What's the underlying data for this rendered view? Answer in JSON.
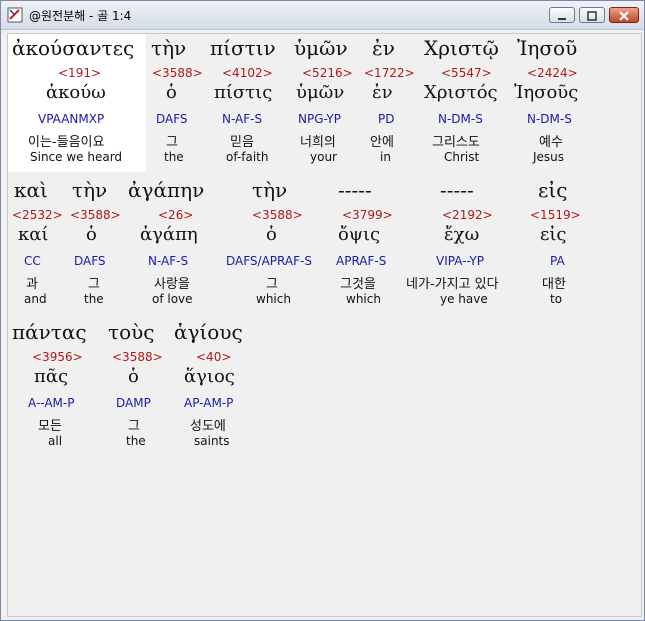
{
  "window": {
    "title": "@원전분해 - 골 1:4"
  },
  "icons": [
    "app-icon",
    "minimize-icon",
    "maximize-icon",
    "close-icon"
  ],
  "colors": {
    "strong": "#b01818",
    "parse": "#1a1aa8"
  },
  "rows": [
    [
      {
        "greek": "ἀκούσαντες",
        "strong": "<191>",
        "lemma": "ἀκούω",
        "parse": "VPAANMXP",
        "korean": "이는-들음이요",
        "english": "Since we heard"
      },
      {
        "greek": "τὴν",
        "strong": "<3588>",
        "lemma": "ὁ",
        "parse": "DAFS",
        "korean": "그",
        "english": "the"
      },
      {
        "greek": "πίστιν",
        "strong": "<4102>",
        "lemma": "πίστις",
        "parse": "N-AF-S",
        "korean": "믿음",
        "english": "of-faith"
      },
      {
        "greek": "ὑμῶν",
        "strong": "<5216>",
        "lemma": "ὑμῶν",
        "parse": "NPG-YP",
        "korean": "너희의",
        "english": "your"
      },
      {
        "greek": "ἐν",
        "strong": "<1722>",
        "lemma": "ἐν",
        "parse": "PD",
        "korean": "안에",
        "english": "in"
      },
      {
        "greek": "Χριστῷ",
        "strong": "<5547>",
        "lemma": "Χριστός",
        "parse": "N-DM-S",
        "korean": "그리스도",
        "english": "Christ"
      },
      {
        "greek": "Ἰησοῦ",
        "strong": "<2424>",
        "lemma": "Ἰησοῦς",
        "parse": "N-DM-S",
        "korean": "예수",
        "english": "Jesus"
      }
    ],
    [
      {
        "greek": "καὶ",
        "strong": "<2532>",
        "lemma": "καί",
        "parse": "CC",
        "korean": "과",
        "english": "and"
      },
      {
        "greek": "τὴν",
        "strong": "<3588>",
        "lemma": "ὁ",
        "parse": "DAFS",
        "korean": "그",
        "english": "the"
      },
      {
        "greek": "ἀγάπην",
        "strong": "<26>",
        "lemma": "ἀγάπη",
        "parse": "N-AF-S",
        "korean": "사랑을",
        "english": "of love"
      },
      {
        "greek": "τὴν",
        "strong": "<3588>",
        "lemma": "ὁ",
        "parse": "DAFS/APRAF-S",
        "korean": "그",
        "english": "which"
      },
      {
        "greek": "-----",
        "strong": "<3799>",
        "lemma": "ὄψις",
        "parse": "APRAF-S",
        "korean": "그것을",
        "english": "which"
      },
      {
        "greek": "-----",
        "strong": "<2192>",
        "lemma": "ἔχω",
        "parse": "VIPA--YP",
        "korean": "네가-가지고 있다",
        "english": "ye have"
      },
      {
        "greek": "εἰς",
        "strong": "<1519>",
        "lemma": "εἰς",
        "parse": "PA",
        "korean": "대한",
        "english": "to"
      }
    ],
    [
      {
        "greek": "πάντας",
        "strong": "<3956>",
        "lemma": "πᾶς",
        "parse": "A--AM-P",
        "korean": "모든",
        "english": "all"
      },
      {
        "greek": "τοὺς",
        "strong": "<3588>",
        "lemma": "ὁ",
        "parse": "DAMP",
        "korean": "그",
        "english": "the"
      },
      {
        "greek": "ἁγίους",
        "strong": "<40>",
        "lemma": "ἅγιος",
        "parse": "AP-AM-P",
        "korean": "성도에",
        "english": "saints"
      }
    ]
  ]
}
